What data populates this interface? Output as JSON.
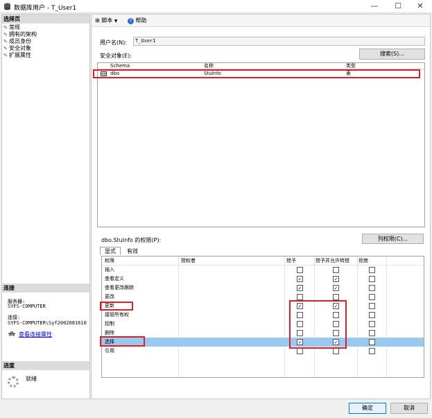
{
  "window": {
    "title": "数据库用户 - T_User1"
  },
  "left": {
    "select_page_header": "选择页",
    "pages": [
      "常规",
      "拥有的架构",
      "成员身份",
      "安全对象",
      "扩展属性"
    ],
    "connection_header": "连接",
    "server_label": "服务器:",
    "server_value": "SYFS-COMPUTER",
    "connection_label": "连接:",
    "connection_value": "SYFS-COMPUTER\\Syf2002081610",
    "view_connection_properties": "查看连接属性",
    "progress_header": "进度",
    "progress_status": "就绪"
  },
  "toolbar": {
    "script": "脚本",
    "help": "帮助"
  },
  "form": {
    "username_label": "用户名(N):",
    "username_value": "T_User1",
    "securables_label": "安全对象(E):",
    "search_button": "搜索(S)..."
  },
  "securables": {
    "columns": [
      "Schema",
      "名称",
      "类型"
    ],
    "rows": [
      {
        "schema": "dbo",
        "name": "StuInfo",
        "type": "表"
      }
    ]
  },
  "permissions": {
    "label": "dbo.StuInfo 的权限(P):",
    "column_permissions_button": "列权限(C)...",
    "tabs": [
      "显式",
      "有效"
    ],
    "columns": [
      "权限",
      "授权者",
      "授予",
      "授予并允许转授",
      "拒绝"
    ],
    "rows": [
      {
        "name": "插入",
        "grantor": "",
        "grant": false,
        "with_grant": false,
        "deny": false
      },
      {
        "name": "查看定义",
        "grantor": "",
        "grant": true,
        "with_grant": true,
        "deny": false
      },
      {
        "name": "查看更改跟踪",
        "grantor": "",
        "grant": true,
        "with_grant": true,
        "deny": false
      },
      {
        "name": "更改",
        "grantor": "",
        "grant": false,
        "with_grant": false,
        "deny": false
      },
      {
        "name": "更新",
        "grantor": "",
        "grant": true,
        "with_grant": true,
        "deny": false
      },
      {
        "name": "接管所有权",
        "grantor": "",
        "grant": false,
        "with_grant": false,
        "deny": false
      },
      {
        "name": "控制",
        "grantor": "",
        "grant": false,
        "with_grant": false,
        "deny": false
      },
      {
        "name": "删除",
        "grantor": "",
        "grant": false,
        "with_grant": false,
        "deny": false
      },
      {
        "name": "选择",
        "grantor": "",
        "grant": true,
        "with_grant": true,
        "deny": false
      },
      {
        "name": "引用",
        "grantor": "",
        "grant": false,
        "with_grant": false,
        "deny": false
      }
    ],
    "selected_row": "选择"
  },
  "buttons": {
    "ok": "确定",
    "cancel": "取消"
  },
  "colors": {
    "selection": "#99c9ef",
    "highlight_box": "#e01c24",
    "link": "#0000ee"
  },
  "icons": [
    "database-icon",
    "minimize-icon",
    "maximize-icon",
    "close-icon",
    "wrench-icon",
    "script-icon",
    "help-icon",
    "connection-icon",
    "table-icon",
    "spinner-icon"
  ]
}
